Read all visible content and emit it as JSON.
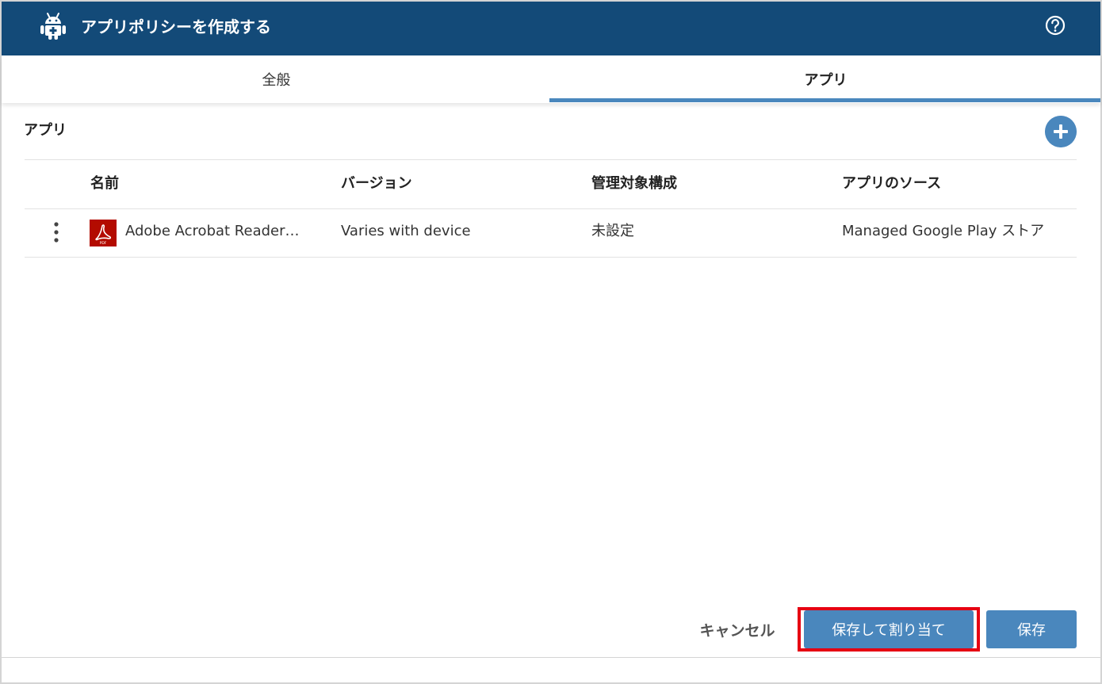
{
  "header": {
    "title": "アプリポリシーを作成する",
    "app_icon": "android-icon",
    "help_icon": "help-circle-icon",
    "background_color": "#134a78"
  },
  "tabs": [
    {
      "label": "全般",
      "active": false
    },
    {
      "label": "アプリ",
      "active": true
    }
  ],
  "section": {
    "title": "アプリ",
    "add_icon": "plus-icon"
  },
  "table": {
    "columns": [
      "名前",
      "バージョン",
      "管理対象構成",
      "アプリのソース"
    ],
    "rows": [
      {
        "menu_icon": "more-vertical-icon",
        "icon": "pdf-icon",
        "name": "Adobe Acrobat Reader…",
        "version": "Varies with device",
        "managed_config": "未設定",
        "source": "Managed Google Play ストア"
      }
    ]
  },
  "footer": {
    "cancel_label": "キャンセル",
    "save_assign_label": "保存して割り当て",
    "save_label": "保存",
    "highlight_color": "#e60012",
    "accent_color": "#4a87bd"
  }
}
